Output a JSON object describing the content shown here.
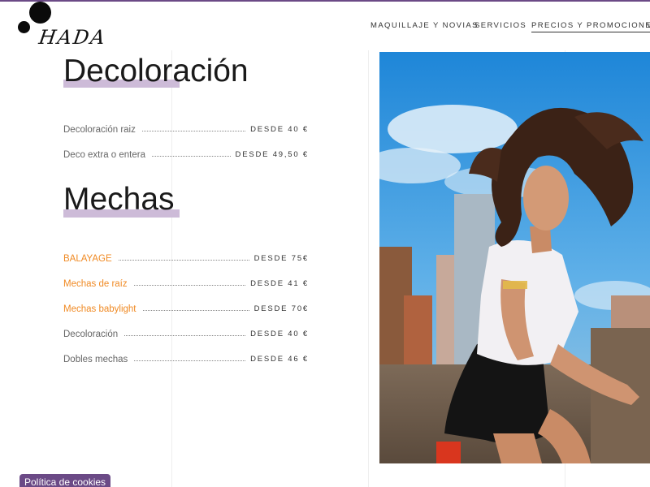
{
  "brand": {
    "name": "HADA"
  },
  "nav": {
    "items": [
      "MAQUILLAJE Y NOVIAS",
      "SERVICIOS",
      "PRECIOS Y PROMOCIONES",
      "V"
    ]
  },
  "sections": [
    {
      "title": "Decoloración",
      "items": [
        {
          "name": "Decoloración raiz",
          "price": "DESDE 40 €"
        },
        {
          "name": "Deco extra o entera",
          "price": "DESDE 49,50 €"
        }
      ]
    },
    {
      "title": "Mechas",
      "items": [
        {
          "name": "BALAYAGE",
          "price": "DESDE 75€"
        },
        {
          "name": "Mechas de raíz",
          "price": "DESDE 41 €"
        },
        {
          "name": "Mechas babylight",
          "price": "DESDE 70€"
        },
        {
          "name": "Decoloración",
          "price": "DESDE 40 €"
        },
        {
          "name": "Dobles mechas",
          "price": "DESDE 46 €"
        }
      ]
    }
  ],
  "cookies": {
    "label": "Política de cookies"
  },
  "colors": {
    "accent": "#6b4a86",
    "highlight": "#cdbbd8",
    "link": "#f08a24"
  }
}
